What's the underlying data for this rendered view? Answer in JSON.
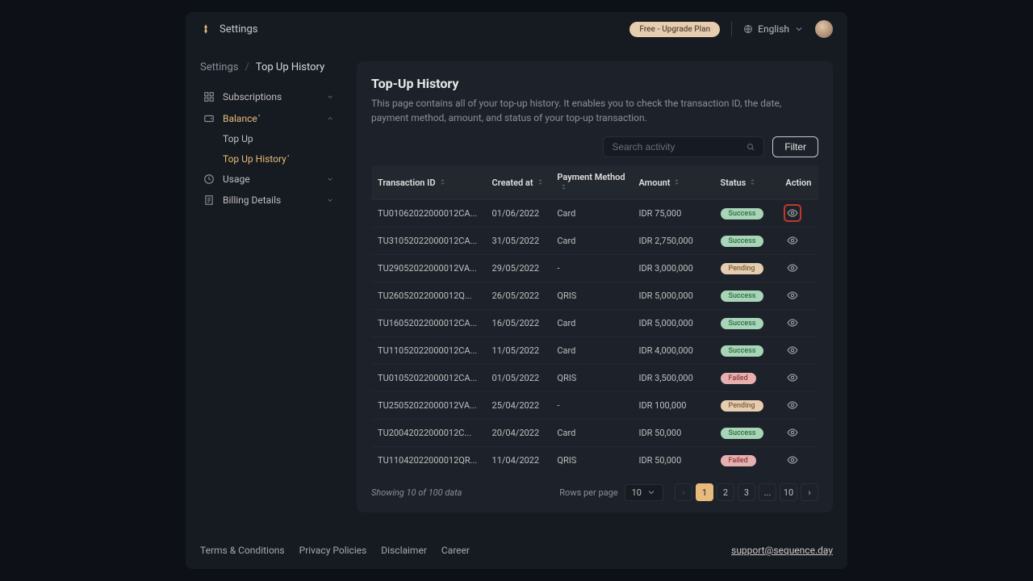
{
  "topbar": {
    "title": "Settings",
    "upgrade": "Free - Upgrade Plan",
    "language": "English"
  },
  "breadcrumb": {
    "a": "Settings",
    "b": "Top Up History"
  },
  "sidebar": {
    "subscriptions": "Subscriptions",
    "balance": "Balance",
    "topup": "Top Up",
    "topup_history": "Top Up History",
    "usage": "Usage",
    "billing": "Billing Details"
  },
  "page": {
    "title": "Top-Up History",
    "subtitle": "This page contains all of your top-up history. It enables you to check the transaction ID, the date, payment method, amount, and status of your top-up transaction."
  },
  "toolbar": {
    "search_placeholder": "Search activity",
    "filter_label": "Filter"
  },
  "columns": {
    "id": "Transaction ID",
    "created": "Created at",
    "method": "Payment Method",
    "amount": "Amount",
    "status": "Status",
    "action": "Action"
  },
  "status_labels": {
    "success": "Success",
    "pending": "Pending",
    "failed": "Failed"
  },
  "rows": [
    {
      "id": "TU01062022000012CA...",
      "created": "01/06/2022",
      "method": "Card",
      "amount": "IDR 75,000",
      "status": "success",
      "highlight": true
    },
    {
      "id": "TU31052022000012CA...",
      "created": "31/05/2022",
      "method": "Card",
      "amount": "IDR 2,750,000",
      "status": "success"
    },
    {
      "id": "TU29052022000012VA...",
      "created": "29/05/2022",
      "method": "-",
      "amount": "IDR 3,000,000",
      "status": "pending"
    },
    {
      "id": "TU26052022000012Q...",
      "created": "26/05/2022",
      "method": "QRIS",
      "amount": "IDR 5,000,000",
      "status": "success"
    },
    {
      "id": "TU16052022000012CA...",
      "created": "16/05/2022",
      "method": "Card",
      "amount": "IDR 5,000,000",
      "status": "success"
    },
    {
      "id": "TU11052022000012CA...",
      "created": "11/05/2022",
      "method": "Card",
      "amount": "IDR 4,000,000",
      "status": "success"
    },
    {
      "id": "TU01052022000012CA...",
      "created": "01/05/2022",
      "method": "QRIS",
      "amount": "IDR 3,500,000",
      "status": "failed"
    },
    {
      "id": "TU25052022000012VA...",
      "created": "25/04/2022",
      "method": "-",
      "amount": "IDR 100,000",
      "status": "pending"
    },
    {
      "id": "TU20042022000012C...",
      "created": "20/04/2022",
      "method": "Card",
      "amount": "IDR 50,000",
      "status": "success"
    },
    {
      "id": "TU11042022000012QR...",
      "created": "11/04/2022",
      "method": "QRIS",
      "amount": "IDR 50,000",
      "status": "failed"
    }
  ],
  "pagination": {
    "showing": "Showing 10 of 100 data",
    "rows_label": "Rows per page",
    "rows_value": "10",
    "pages": [
      "1",
      "2",
      "3",
      "...",
      "10"
    ],
    "active_page": "1"
  },
  "footer": {
    "links": [
      "Terms & Conditions",
      "Privacy Policies",
      "Disclaimer",
      "Career"
    ],
    "support": "support@sequence.day"
  }
}
